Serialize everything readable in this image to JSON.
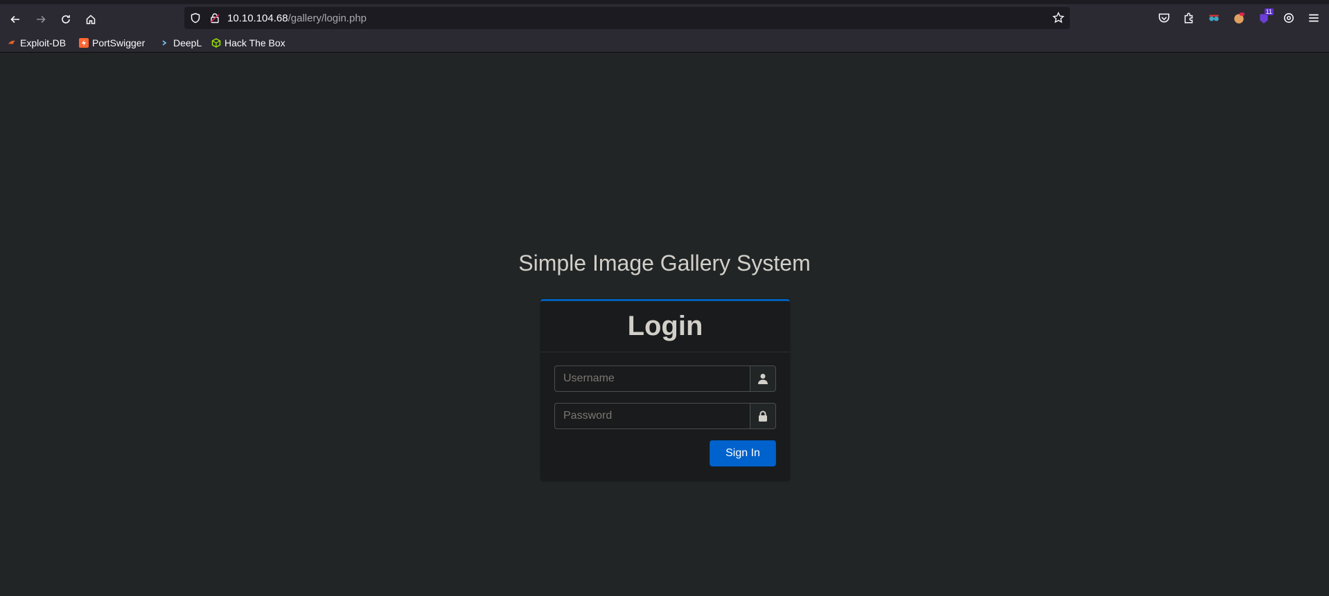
{
  "browser": {
    "url_host": "10.10.104.68",
    "url_path": "/gallery/login.php",
    "ext_badge": "11"
  },
  "bookmarks": [
    {
      "label": "Exploit-DB",
      "icon": "exploit-db-icon"
    },
    {
      "label": "PortSwigger",
      "icon": "portswigger-icon"
    },
    {
      "label": "DeepL",
      "icon": "deepl-icon"
    },
    {
      "label": "Hack The Box",
      "icon": "hackthebox-icon"
    }
  ],
  "page": {
    "app_title": "Simple Image Gallery System",
    "card_title": "Login",
    "username_placeholder": "Username",
    "password_placeholder": "Password",
    "signin_label": "Sign In"
  },
  "colors": {
    "page_bg": "#212526",
    "card_bg": "#191b1c",
    "accent": "#0062cc"
  }
}
